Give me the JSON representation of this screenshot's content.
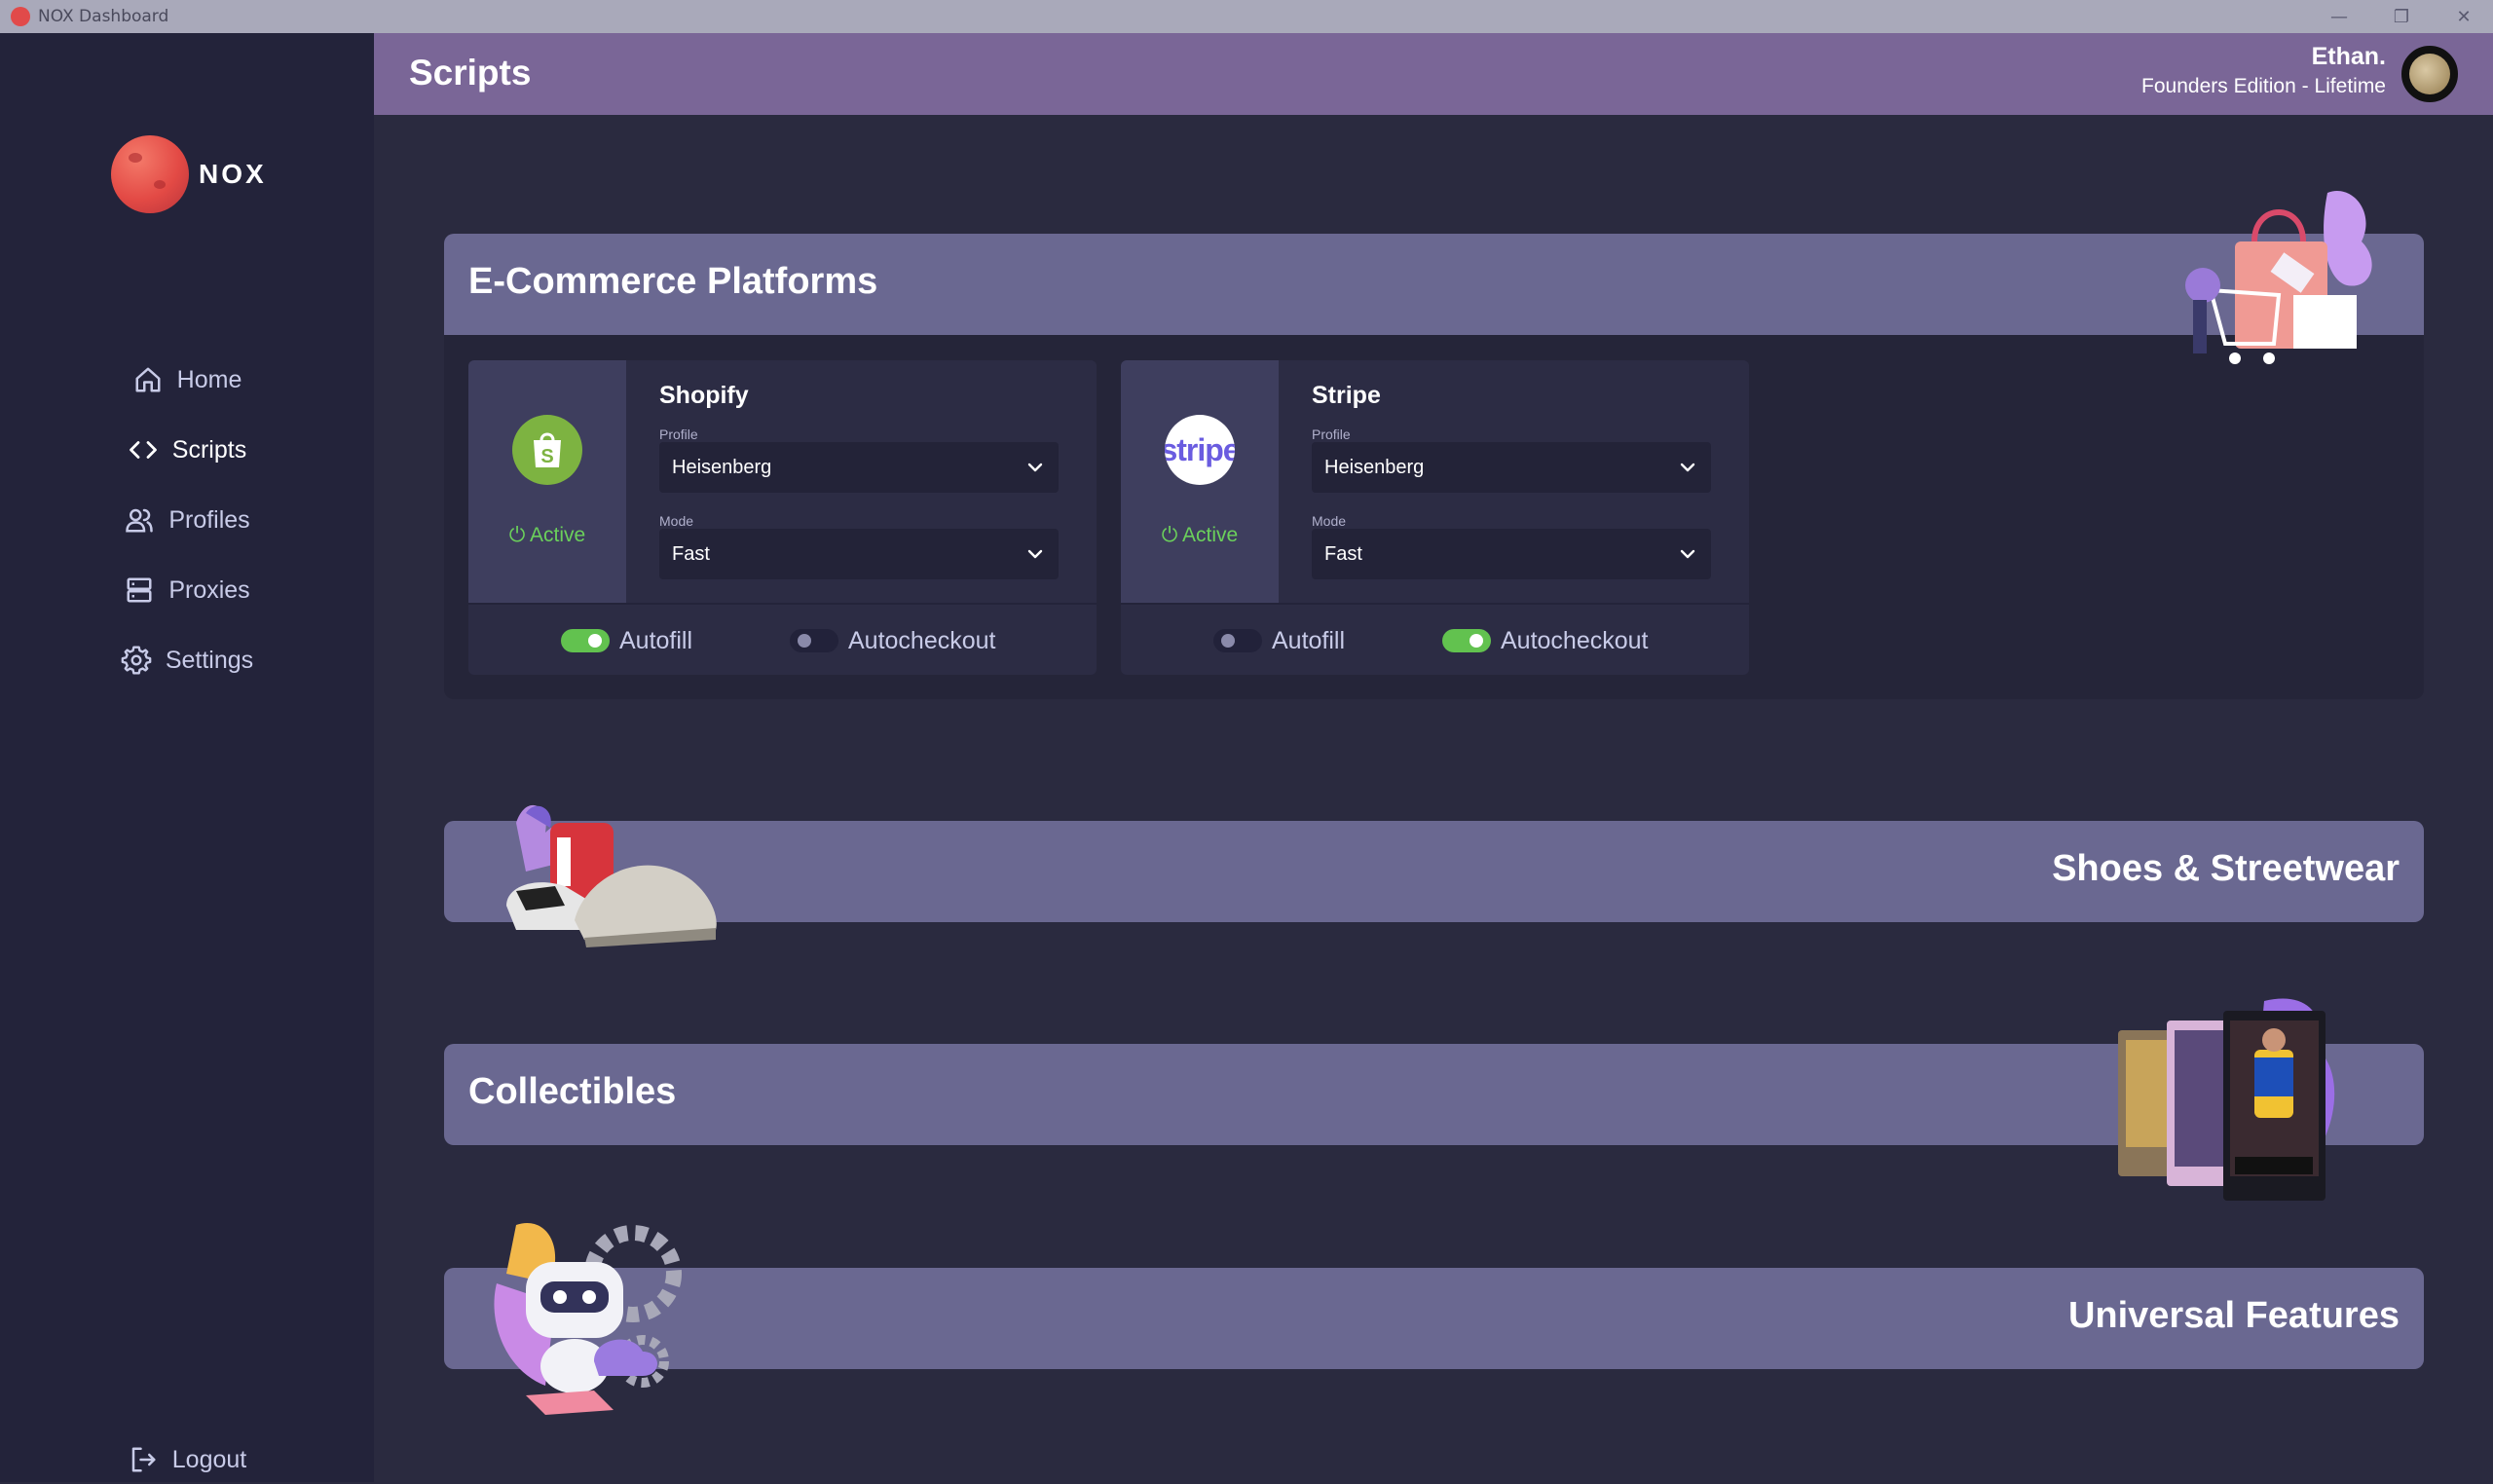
{
  "window": {
    "title": "NOX Dashboard",
    "minimize": "—",
    "restore": "❐",
    "close": "✕"
  },
  "brand": {
    "name": "NOX"
  },
  "sidebar": {
    "items": [
      {
        "label": "Home",
        "icon": "home-icon"
      },
      {
        "label": "Scripts",
        "icon": "code-icon"
      },
      {
        "label": "Profiles",
        "icon": "users-icon"
      },
      {
        "label": "Proxies",
        "icon": "server-icon"
      },
      {
        "label": "Settings",
        "icon": "gear-icon"
      }
    ],
    "logout": "Logout"
  },
  "header": {
    "title": "Scripts",
    "user_name": "Ethan.",
    "user_plan": "Founders Edition - Lifetime"
  },
  "sections": {
    "ecommerce": {
      "title": "E-Commerce Platforms"
    },
    "shoes": {
      "title": "Shoes & Streetwear"
    },
    "collectibles": {
      "title": "Collectibles"
    },
    "universal": {
      "title": "Universal Features"
    }
  },
  "cards": [
    {
      "name": "Shopify",
      "logo_text": "",
      "status": "Active",
      "profile_label": "Profile",
      "profile_value": "Heisenberg",
      "mode_label": "Mode",
      "mode_value": "Fast",
      "autofill_label": "Autofill",
      "autofill_on": true,
      "autocheckout_label": "Autocheckout",
      "autocheckout_on": false
    },
    {
      "name": "Stripe",
      "logo_text": "stripe",
      "status": "Active",
      "profile_label": "Profile",
      "profile_value": "Heisenberg",
      "mode_label": "Mode",
      "mode_value": "Fast",
      "autofill_label": "Autofill",
      "autofill_on": false,
      "autocheckout_label": "Autocheckout",
      "autocheckout_on": true
    }
  ],
  "colors": {
    "accent": "#7a6697",
    "active": "#6bd05b",
    "toggle_on": "#62c24f",
    "section_bar": "#6a6891"
  }
}
